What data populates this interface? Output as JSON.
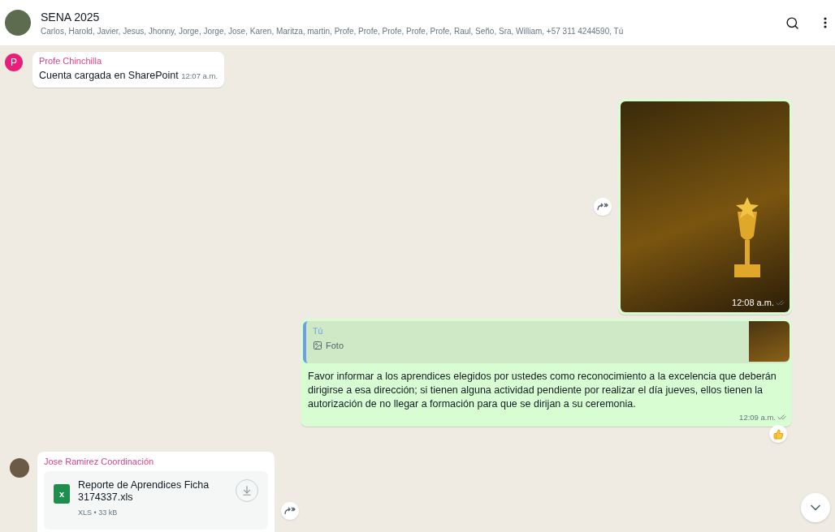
{
  "header": {
    "title": "SENA 2025",
    "participants": "Carlos, Harold, Javier, Jesus, Jhonny, Jorge, Jorge, Jose, Karen, Maritza, martin, Profe, Profe, Profe, Profe, Profe, Raul, Seño, Sra, William, +57 311 4244590, Tú"
  },
  "messages": [
    {
      "kind": "text",
      "outgoing": false,
      "sender": "Profe Chinchilla",
      "avatar_letter": "P",
      "text": "Cuenta cargada en SharePoint",
      "time": "12:07 a.m."
    },
    {
      "kind": "image",
      "outgoing": true,
      "time": "12:08 a.m.",
      "delivered": true,
      "forward": true
    },
    {
      "kind": "reply",
      "outgoing": true,
      "quote_sender": "Tú",
      "quote_label": "Foto",
      "text": "Favor informar a los aprendices elegidos por ustedes como reconocimiento a la excelencia que deberán dirigirse a esa dirección; si tienen alguna actividad pendiente por realizar el día jueves, ellos tienen la autorización de no llegar a formación para que se dirijan a su ceremonia.",
      "time": "12:09 a.m.",
      "delivered": true,
      "reacted": true
    },
    {
      "kind": "document",
      "outgoing": false,
      "sender": "Jose Ramirez Coordinación",
      "file_letter": "x",
      "file_name": "Reporte de Aprendices Ficha 3174337.xls",
      "file_meta": "XLS • 33 kB",
      "forward": true
    }
  ]
}
